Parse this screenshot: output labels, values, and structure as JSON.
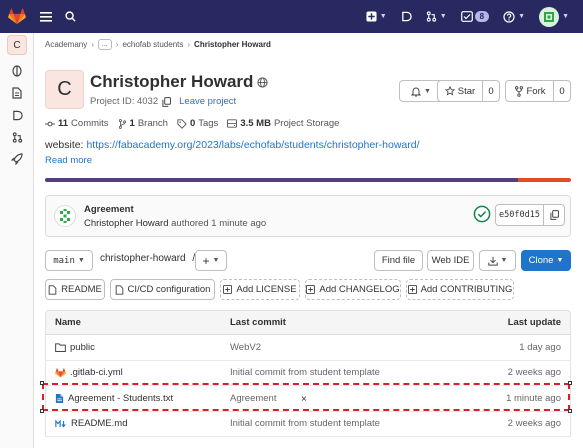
{
  "topbar": {
    "badge_count": "8"
  },
  "sidebar": {
    "project_initial": "C"
  },
  "breadcrumb": {
    "items": [
      "Academany",
      "...",
      "echofab students",
      "Christopher Howard"
    ]
  },
  "project": {
    "initial": "C",
    "name": "Christopher Howard",
    "id_text": "Project ID: 4032",
    "leave_label": "Leave project"
  },
  "actions": {
    "star_label": "Star",
    "star_count": "0",
    "fork_label": "Fork",
    "fork_count": "0"
  },
  "stats": {
    "commits_count": "11",
    "commits_label": "Commits",
    "branch_count": "1",
    "branch_label": "Branch",
    "tags_count": "0",
    "tags_label": "Tags",
    "storage_size": "3.5 MB",
    "storage_label": "Project Storage"
  },
  "description": {
    "prefix": "website: ",
    "url": "https://fabacademy.org/2023/labs/echofab/students/christopher-howard/",
    "read_more": "Read more"
  },
  "colors": {
    "accent": "#1f75cb",
    "lang_primary": "#563d7c",
    "lang_secondary": "#e34c26",
    "topbar": "#292961",
    "success": "#108548",
    "highlight": "#d4202a"
  },
  "last_commit": {
    "title": "Agreement",
    "author": "Christopher Howard",
    "meta": " authored 1 minute ago",
    "sha": "e50f0d15"
  },
  "repo_toolbar": {
    "branch": "main",
    "path": "christopher-howard",
    "path_sep": "/",
    "find_file": "Find file",
    "web_ide": "Web IDE",
    "clone": "Clone"
  },
  "quick_links": {
    "readme": "README",
    "cicd": "CI/CD configuration",
    "license": "Add LICENSE",
    "changelog": "Add CHANGELOG",
    "contributing": "Add CONTRIBUTING"
  },
  "file_table": {
    "headers": {
      "name": "Name",
      "last_commit": "Last commit",
      "last_update": "Last update"
    },
    "rows": [
      {
        "name": "public",
        "icon": "folder-icon",
        "commit": "WebV2",
        "date": "1 day ago"
      },
      {
        "name": ".gitlab-ci.yml",
        "icon": "gitlab-file-icon",
        "commit": "Initial commit from student template",
        "date": "2 weeks ago"
      },
      {
        "name": "Agreement - Students.txt",
        "icon": "text-file-icon",
        "commit": "Agreement",
        "date": "1 minute ago"
      },
      {
        "name": "README.md",
        "icon": "markdown-file-icon",
        "commit": "Initial commit from student template",
        "date": "2 weeks ago"
      }
    ]
  },
  "overlay": {
    "close_glyph": "×"
  }
}
